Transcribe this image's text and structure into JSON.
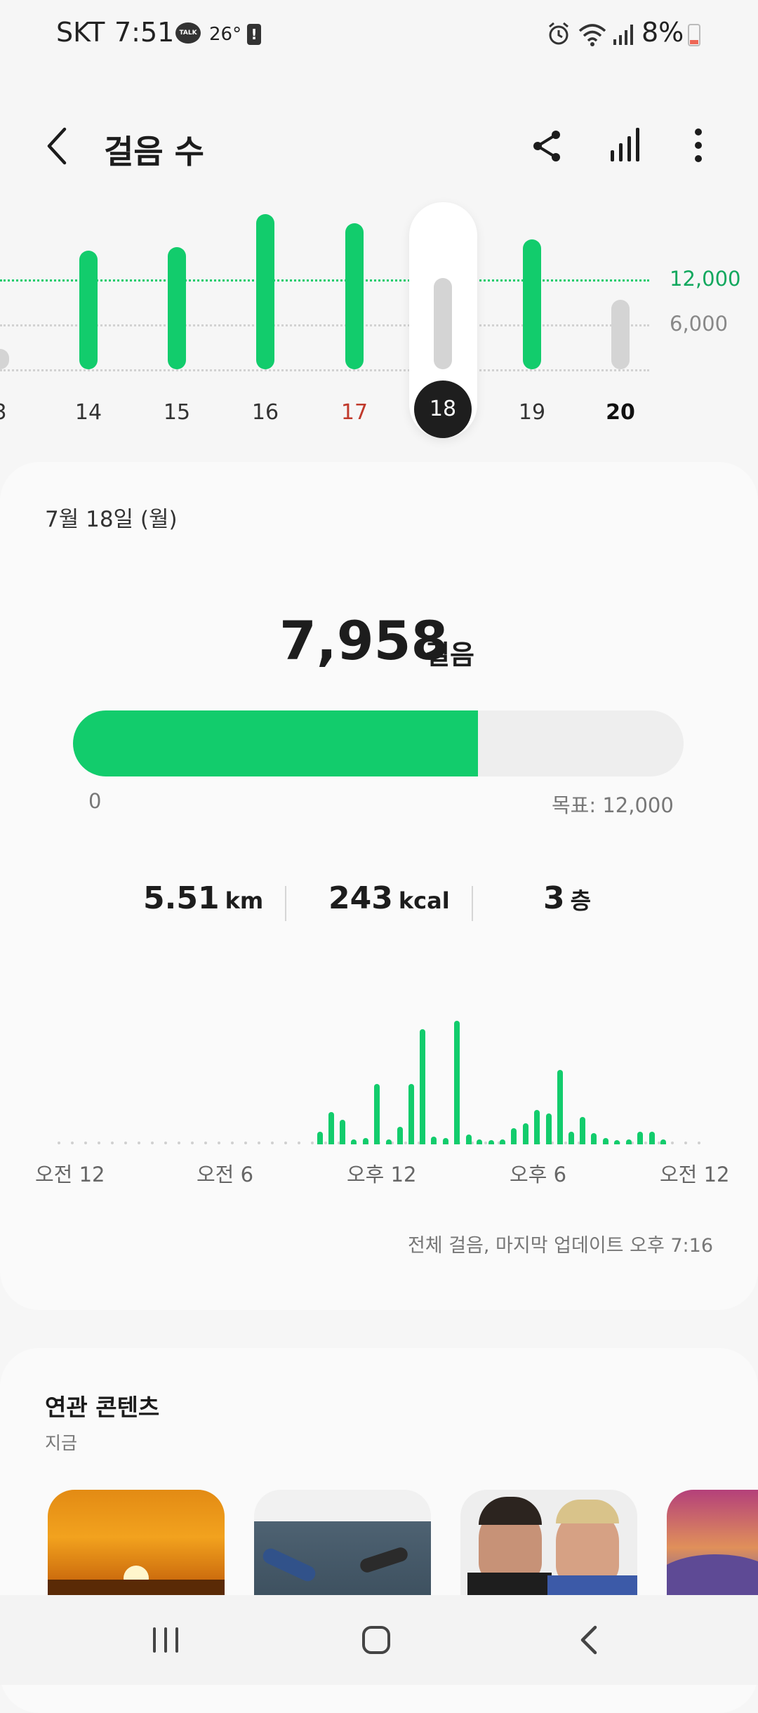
{
  "status_bar": {
    "carrier": "SKT",
    "time": "7:51",
    "talk_badge": "TALK",
    "temperature": "26°",
    "battery": "8%"
  },
  "header": {
    "title": "걸음 수",
    "icons": [
      "back-icon",
      "share-icon",
      "bar-chart-icon",
      "more-icon"
    ]
  },
  "week_chart": {
    "axis_labels": [
      "12,000",
      "6,000"
    ],
    "days": [
      {
        "label": "3",
        "color": "#333333",
        "level": 0.11,
        "state": "gray"
      },
      {
        "label": "14",
        "color": "#333333",
        "level": 0.65,
        "state": "green"
      },
      {
        "label": "15",
        "color": "#333333",
        "level": 0.67,
        "state": "green"
      },
      {
        "label": "16",
        "color": "#333333",
        "level": 0.85,
        "state": "green"
      },
      {
        "label": "17",
        "color": "#c0392b",
        "level": 0.8,
        "state": "green"
      },
      {
        "label": "18",
        "color": "#ffffff",
        "level": 0.5,
        "state": "selected"
      },
      {
        "label": "19",
        "color": "#333333",
        "level": 0.71,
        "state": "green"
      },
      {
        "label": "20",
        "color": "#111111",
        "level": 0.38,
        "state": "gray",
        "bold": true
      }
    ],
    "colors": {
      "green": "#12cc6c",
      "gray": "#d4d4d4",
      "goal_line": "#12cc6c"
    }
  },
  "summary": {
    "date": "7월 18일 (월)",
    "steps": "7,958",
    "steps_unit": "걸음",
    "progress_fraction": 0.663,
    "progress_min": "0",
    "goal": "목표: 12,000",
    "stats": [
      {
        "value": "5.51",
        "unit": "km"
      },
      {
        "value": "243",
        "unit": "kcal"
      },
      {
        "value": "3",
        "unit": "층"
      }
    ]
  },
  "hourly_chart": {
    "x_labels": [
      "오전 12",
      "오전 6",
      "오후 12",
      "오후 6",
      "오전 12"
    ],
    "bars": [
      {
        "t": 0.408,
        "level": 0.1
      },
      {
        "t": 0.425,
        "level": 0.26
      },
      {
        "t": 0.443,
        "level": 0.2
      },
      {
        "t": 0.461,
        "level": 0.04
      },
      {
        "t": 0.479,
        "level": 0.05
      },
      {
        "t": 0.497,
        "level": 0.49
      },
      {
        "t": 0.515,
        "level": 0.04
      },
      {
        "t": 0.533,
        "level": 0.14
      },
      {
        "t": 0.55,
        "level": 0.49
      },
      {
        "t": 0.568,
        "level": 0.93
      },
      {
        "t": 0.586,
        "level": 0.06
      },
      {
        "t": 0.604,
        "level": 0.05
      },
      {
        "t": 0.622,
        "level": 1.0
      },
      {
        "t": 0.64,
        "level": 0.08
      },
      {
        "t": 0.657,
        "level": 0.04
      },
      {
        "t": 0.675,
        "level": 0.03
      },
      {
        "t": 0.693,
        "level": 0.04
      },
      {
        "t": 0.711,
        "level": 0.13
      },
      {
        "t": 0.729,
        "level": 0.17
      },
      {
        "t": 0.747,
        "level": 0.28
      },
      {
        "t": 0.765,
        "level": 0.25
      },
      {
        "t": 0.783,
        "level": 0.6
      },
      {
        "t": 0.8,
        "level": 0.1
      },
      {
        "t": 0.818,
        "level": 0.22
      },
      {
        "t": 0.836,
        "level": 0.09
      },
      {
        "t": 0.854,
        "level": 0.05
      },
      {
        "t": 0.872,
        "level": 0.03
      },
      {
        "t": 0.89,
        "level": 0.04
      },
      {
        "t": 0.908,
        "level": 0.1
      },
      {
        "t": 0.926,
        "level": 0.1
      },
      {
        "t": 0.944,
        "level": 0.04
      }
    ],
    "update_note": "전체 걸음, 마지막 업데이트 오후 7:16"
  },
  "related": {
    "title": "연관 콘텐츠",
    "subtitle": "지금",
    "thumbnails": [
      "sunset-thumbnail",
      "workout-sofa-thumbnail",
      "trainers-portrait-thumbnail",
      "mountain-sunset-thumbnail"
    ]
  },
  "nav": {
    "icons": [
      "recent-apps-icon",
      "home-icon",
      "back-nav-icon"
    ]
  }
}
